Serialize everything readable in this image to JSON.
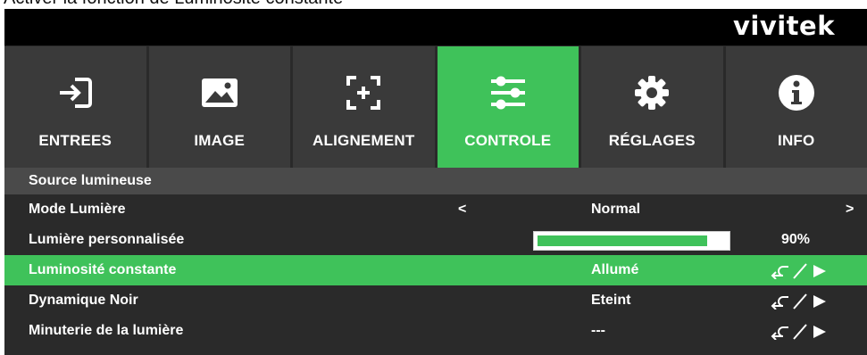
{
  "caption": "Activer la fonction de Luminosité constante",
  "brand": {
    "logo": "vivitek"
  },
  "colors": {
    "accent": "#3fc25a",
    "panel": "#2a2a2a",
    "tab": "#3a3a3a",
    "section": "#4a4a4a"
  },
  "tabs": [
    {
      "label": "ENTREES",
      "icon": "input-icon",
      "active": false
    },
    {
      "label": "IMAGE",
      "icon": "image-icon",
      "active": false
    },
    {
      "label": "ALIGNEMENT",
      "icon": "alignment-icon",
      "active": false
    },
    {
      "label": "CONTROLE",
      "icon": "sliders-icon",
      "active": true
    },
    {
      "label": "RÉGLAGES",
      "icon": "gear-icon",
      "active": false
    },
    {
      "label": "INFO",
      "icon": "info-icon",
      "active": false
    }
  ],
  "menu": {
    "section": "Source lumineuse",
    "mode_lumiere": {
      "label": "Mode Lumière",
      "value": "Normal",
      "prev": "<",
      "next": ">"
    },
    "lumiere_perso": {
      "label": "Lumière personnalisée",
      "percent": 90,
      "percent_text": "90%"
    },
    "luminosite_constante": {
      "label": "Luminosité constante",
      "value": "Allumé",
      "action": "enter-play-icon",
      "highlighted": true
    },
    "dynamique_noir": {
      "label": "Dynamique Noir",
      "value": "Eteint",
      "action": "enter-play-icon"
    },
    "minuterie": {
      "label": "Minuterie de la lumière",
      "value": "---",
      "action": "enter-play-icon"
    }
  }
}
